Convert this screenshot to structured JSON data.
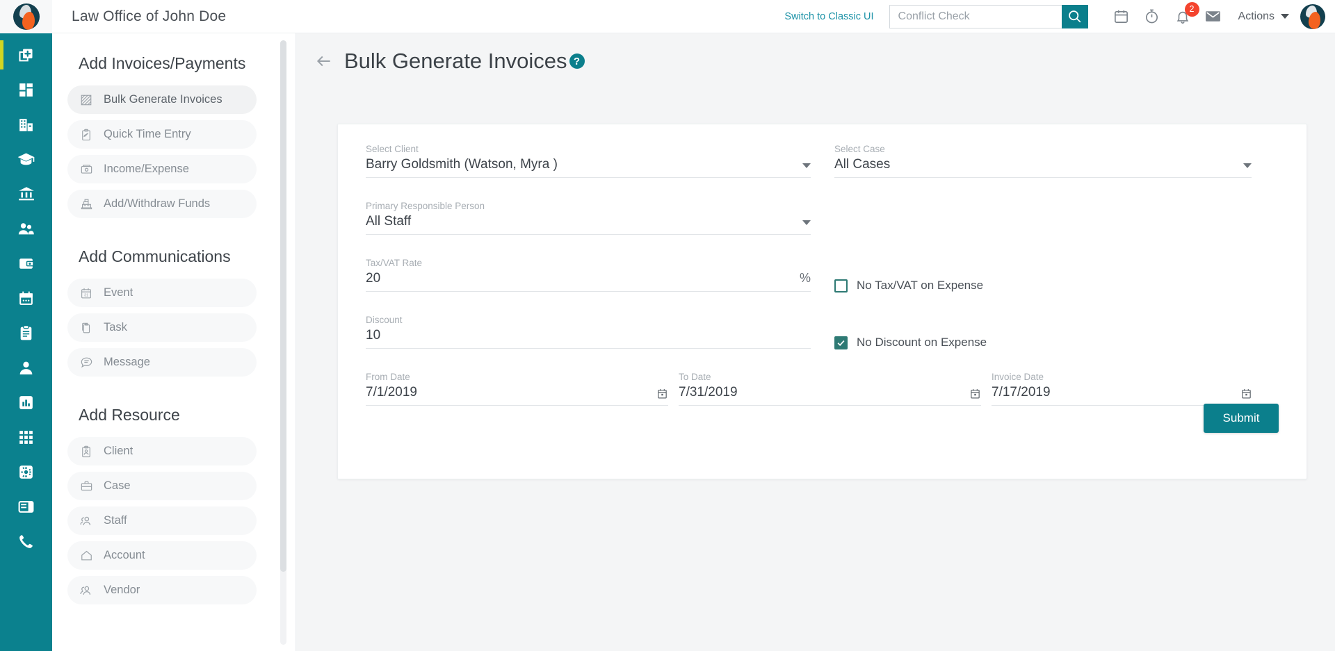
{
  "header": {
    "app_title": "Law Office of John Doe",
    "switch_link": "Switch to Classic UI",
    "search_placeholder": "Conflict Check",
    "search_value": "",
    "search_icon": "search-icon",
    "calendar_icon": "calendar-icon",
    "timer_icon": "stopwatch-icon",
    "bell_icon": "bell-icon",
    "bell_badge": "2",
    "mail_icon": "envelope-icon",
    "actions_label": "Actions",
    "avatar_icon": "user-avatar"
  },
  "rail": {
    "items": [
      {
        "name": "add-new",
        "icon": "add-document-icon",
        "active": true
      },
      {
        "name": "dashboard",
        "icon": "dashboard-grid-icon",
        "active": false
      },
      {
        "name": "firm",
        "icon": "building-icon",
        "active": false
      },
      {
        "name": "education",
        "icon": "graduation-cap-icon",
        "active": false
      },
      {
        "name": "court",
        "icon": "bank-icon",
        "active": false
      },
      {
        "name": "contacts",
        "icon": "people-icon",
        "active": false
      },
      {
        "name": "billing",
        "icon": "wallet-icon",
        "active": false
      },
      {
        "name": "calendar",
        "icon": "calendar-icon",
        "active": false
      },
      {
        "name": "tasks",
        "icon": "clipboard-icon",
        "active": false
      },
      {
        "name": "clients",
        "icon": "person-icon",
        "active": false
      },
      {
        "name": "reports",
        "icon": "bar-chart-icon",
        "active": false
      },
      {
        "name": "apps",
        "icon": "grid-apps-icon",
        "active": false
      },
      {
        "name": "settings",
        "icon": "gear-icon",
        "active": false
      },
      {
        "name": "layout",
        "icon": "layout-panel-icon",
        "active": false
      },
      {
        "name": "phone",
        "icon": "phone-icon",
        "active": false
      }
    ]
  },
  "subnav": {
    "sections": [
      {
        "title": "Add Invoices/Payments",
        "items": [
          {
            "label": "Bulk Generate Invoices",
            "icon": "invoice-batch-icon",
            "active": true
          },
          {
            "label": "Quick Time Entry",
            "icon": "time-entry-icon",
            "active": false
          },
          {
            "label": "Income/Expense",
            "icon": "cash-drawer-icon",
            "active": false
          },
          {
            "label": "Add/Withdraw Funds",
            "icon": "cash-register-icon",
            "active": false
          }
        ]
      },
      {
        "title": "Add Communications",
        "items": [
          {
            "label": "Event",
            "icon": "calendar-31-icon",
            "active": false
          },
          {
            "label": "Task",
            "icon": "task-copy-icon",
            "active": false
          },
          {
            "label": "Message",
            "icon": "chat-bubble-icon",
            "active": false
          }
        ]
      },
      {
        "title": "Add Resource",
        "items": [
          {
            "label": "Client",
            "icon": "client-badge-icon",
            "active": false
          },
          {
            "label": "Case",
            "icon": "briefcase-icon",
            "active": false
          },
          {
            "label": "Staff",
            "icon": "staff-group-icon",
            "active": false
          },
          {
            "label": "Account",
            "icon": "home-icon",
            "active": false
          },
          {
            "label": "Vendor",
            "icon": "vendor-group-icon",
            "active": false
          }
        ]
      }
    ]
  },
  "page": {
    "back_icon": "back-arrow-icon",
    "title": "Bulk Generate Invoices",
    "help_badge": "?"
  },
  "form": {
    "select_client": {
      "label": "Select Client",
      "value": "Barry Goldsmith (Watson, Myra )"
    },
    "select_case": {
      "label": "Select Case",
      "value": "All Cases"
    },
    "primary_person": {
      "label": "Primary Responsible Person",
      "value": "All Staff"
    },
    "tax_rate": {
      "label": "Tax/VAT Rate",
      "value": "20",
      "suffix": "%"
    },
    "discount": {
      "label": "Discount",
      "value": "10"
    },
    "from_date": {
      "label": "From Date",
      "value": "7/1/2019"
    },
    "to_date": {
      "label": "To Date",
      "value": "7/31/2019"
    },
    "invoice_date": {
      "label": "Invoice Date",
      "value": "7/17/2019"
    },
    "no_tax_on_expense": {
      "label": "No Tax/VAT on Expense",
      "checked": false
    },
    "no_discount_on_expense": {
      "label": "No Discount on Expense",
      "checked": true
    },
    "submit_label": "Submit"
  },
  "colors": {
    "teal": "#0b7f8c",
    "rail_teal": "#0b818e",
    "accent_yellow": "#cfd622",
    "checkbox_teal": "#2e7a74",
    "badge_red": "#f4442e",
    "link_teal": "#1e93a8"
  }
}
